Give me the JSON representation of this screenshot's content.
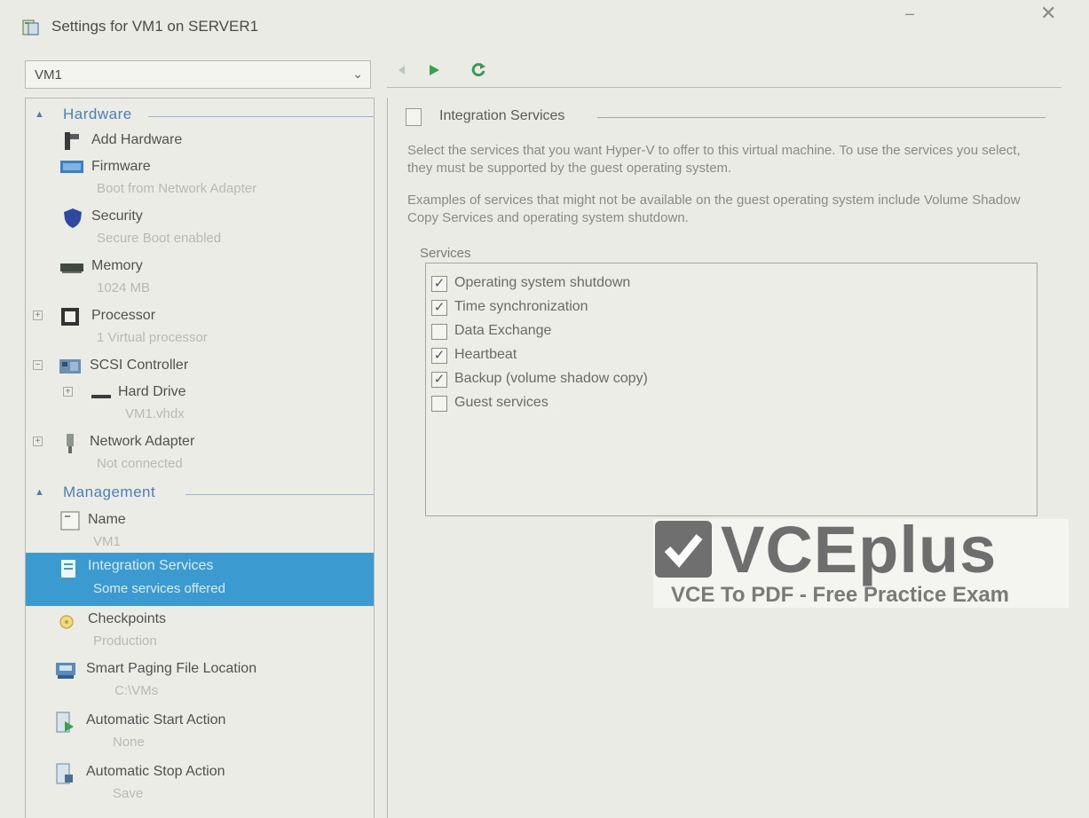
{
  "window": {
    "title": "Settings for VM1 on SERVER1",
    "minimize_glyph": "–",
    "close_glyph": "✕"
  },
  "vm_selector": {
    "value": "VM1",
    "arrow": "⌄"
  },
  "toolbar": {
    "icons": [
      "back-icon",
      "start-icon",
      "refresh-icon"
    ]
  },
  "tree": {
    "hardware_heading": "Hardware",
    "management_heading": "Management",
    "hardware_items": [
      {
        "label": "Add Hardware",
        "detail": "",
        "icon": "add-hardware-icon",
        "expander": ""
      },
      {
        "label": "Firmware",
        "detail": "Boot from Network Adapter",
        "icon": "firmware-icon",
        "expander": ""
      },
      {
        "label": "Security",
        "detail": "Secure Boot enabled",
        "icon": "security-shield-icon",
        "expander": ""
      },
      {
        "label": "Memory",
        "detail": "1024 MB",
        "icon": "memory-icon",
        "expander": ""
      },
      {
        "label": "Processor",
        "detail": "1 Virtual processor",
        "icon": "processor-icon",
        "expander": "+"
      },
      {
        "label": "SCSI Controller",
        "detail": "",
        "icon": "scsi-controller-icon",
        "expander": "−"
      },
      {
        "label": "Hard Drive",
        "detail": "VM1.vhdx",
        "icon": "hard-drive-icon",
        "expander": "+"
      },
      {
        "label": "Network Adapter",
        "detail": "Not connected",
        "icon": "network-adapter-icon",
        "expander": "+"
      }
    ],
    "management_items": [
      {
        "label": "Name",
        "detail": "VM1",
        "icon": "name-icon"
      },
      {
        "label": "Integration Services",
        "detail": "Some services offered",
        "icon": "integration-services-icon",
        "selected": true
      },
      {
        "label": "Checkpoints",
        "detail": "Production",
        "icon": "checkpoints-icon"
      },
      {
        "label": "Smart Paging File Location",
        "detail": "C:\\VMs",
        "icon": "smart-paging-icon"
      },
      {
        "label": "Automatic Start Action",
        "detail": "None",
        "icon": "auto-start-icon"
      },
      {
        "label": "Automatic Stop Action",
        "detail": "Save",
        "icon": "auto-stop-icon"
      }
    ]
  },
  "integration_services": {
    "title": "Integration Services",
    "description_1": "Select the services that you want Hyper-V to offer to this virtual machine. To use the services you select, they must be supported by the guest operating system.",
    "description_2": "Examples of services that might not be available on the guest operating system include Volume Shadow Copy Services and operating system shutdown.",
    "services_label": "Services",
    "services": [
      {
        "label": "Operating system shutdown",
        "checked": true
      },
      {
        "label": "Time synchronization",
        "checked": true
      },
      {
        "label": "Data Exchange",
        "checked": false
      },
      {
        "label": "Heartbeat",
        "checked": true
      },
      {
        "label": "Backup (volume shadow copy)",
        "checked": true
      },
      {
        "label": "Guest services",
        "checked": false
      }
    ]
  },
  "watermark": {
    "brand": "VCEplus",
    "tagline": "VCE To PDF - Free Practice Exam"
  },
  "colors": {
    "selection": "#3b9bd1",
    "section_heading": "#4f7fb0",
    "start_green": "#3aa04a"
  }
}
